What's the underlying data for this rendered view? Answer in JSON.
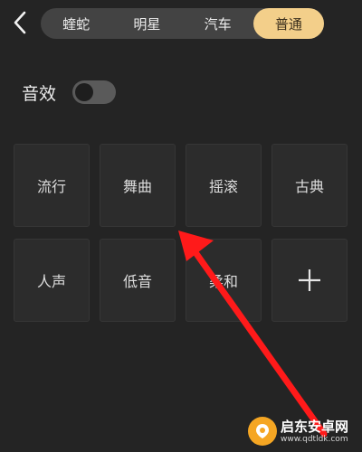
{
  "header": {
    "back_icon": "chevron-left-icon",
    "tabs": [
      {
        "label": "蝰蛇",
        "active": false
      },
      {
        "label": "明星",
        "active": false
      },
      {
        "label": "汽车",
        "active": false
      },
      {
        "label": "普通",
        "active": true
      }
    ]
  },
  "sound_effect": {
    "label": "音效",
    "enabled": false
  },
  "presets": [
    {
      "label": "流行"
    },
    {
      "label": "舞曲"
    },
    {
      "label": "摇滚"
    },
    {
      "label": "古典"
    },
    {
      "label": "人声"
    },
    {
      "label": "低音"
    },
    {
      "label": "柔和"
    },
    {
      "icon": "plus-icon"
    }
  ],
  "watermark": {
    "title": "启东安卓网",
    "url": "www.qdtldk.com"
  },
  "colors": {
    "background": "#242424",
    "active_tab": "#f3cf8a",
    "annotation_arrow": "#ff1a1a"
  }
}
